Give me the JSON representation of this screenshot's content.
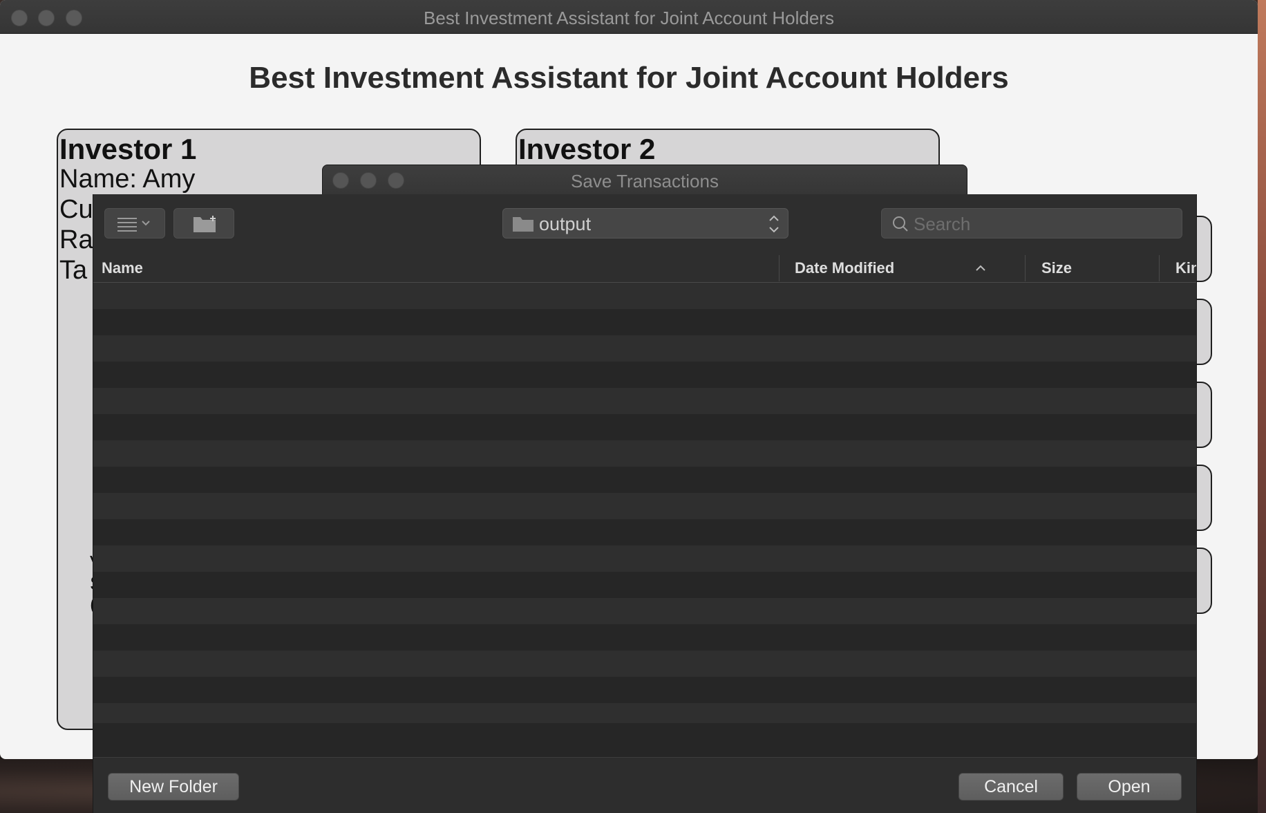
{
  "main_window": {
    "title": "Best Investment Assistant for Joint Account Holders",
    "heading": "Best Investment Assistant for Joint Account Holders"
  },
  "investor1": {
    "title": "Investor 1",
    "name_line": "Name: Amy",
    "line2_partial": "Cu",
    "line3_partial": "Ra",
    "line4_partial": "Ta",
    "fragments": [
      "V",
      "S",
      "("
    ]
  },
  "investor2": {
    "title": "Investor 2"
  },
  "dialog": {
    "title": "Save Transactions",
    "location": "output",
    "search_placeholder": "Search",
    "columns": {
      "name": "Name",
      "date_modified": "Date Modified",
      "size": "Size",
      "kind": "Kin"
    },
    "sort_indicator": "^",
    "buttons": {
      "new_folder": "New Folder",
      "cancel": "Cancel",
      "open": "Open"
    }
  },
  "icons": {
    "view_mode": "list-view-icon",
    "new_folder": "new-folder-icon",
    "folder": "folder-icon",
    "updown": "updown-chevron-icon",
    "search": "search-icon"
  }
}
